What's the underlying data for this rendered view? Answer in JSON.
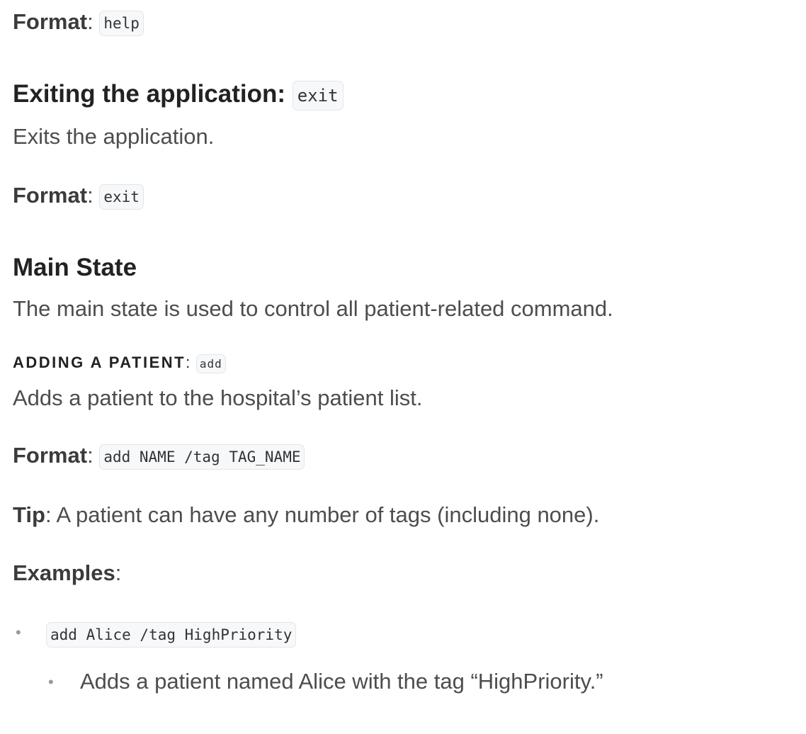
{
  "help_format": {
    "label": "Format",
    "sep": ":",
    "code": "help"
  },
  "exit_section": {
    "heading": "Exiting the application:",
    "heading_code": "exit",
    "description": "Exits the application.",
    "format_label": "Format",
    "format_sep": ":",
    "format_code": "exit"
  },
  "main_state": {
    "heading": "Main State",
    "description": "The main state is used to control all patient-related command."
  },
  "add_patient": {
    "heading": "ADDING A PATIENT",
    "heading_sep": ":",
    "heading_code": "add",
    "description": "Adds a patient to the hospital’s patient list.",
    "format_label": "Format",
    "format_sep": ":",
    "format_code": "add NAME /tag TAG_NAME",
    "tip_label": "Tip",
    "tip_text": ": A patient can have any number of tags (including none).",
    "examples_label": "Examples",
    "examples_sep": ":",
    "examples": [
      {
        "code": "add Alice /tag HighPriority",
        "explanation": "Adds a patient named Alice with the tag “HighPriority.”"
      }
    ],
    "bullet_glyph": "•"
  }
}
